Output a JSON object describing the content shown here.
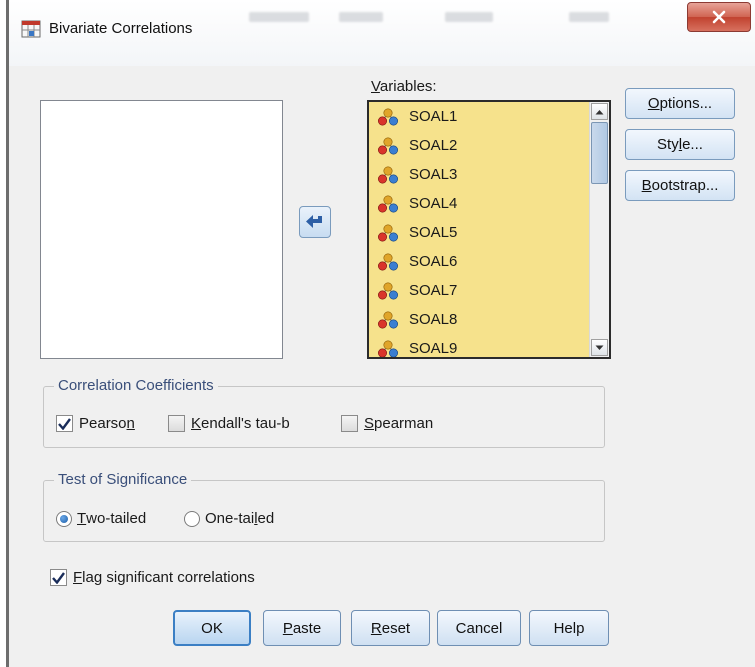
{
  "window": {
    "title": "Bivariate Correlations"
  },
  "variables": {
    "label": "Variables:",
    "label_mnemonic": "V",
    "label_rest": "ariables:",
    "items": [
      "SOAL1",
      "SOAL2",
      "SOAL3",
      "SOAL4",
      "SOAL5",
      "SOAL6",
      "SOAL7",
      "SOAL8",
      "SOAL9"
    ]
  },
  "side_buttons": {
    "options": {
      "pre": "",
      "key": "O",
      "post": "ptions..."
    },
    "style": {
      "pre": "Sty",
      "key": "l",
      "post": "e..."
    },
    "bootstrap": {
      "pre": "",
      "key": "B",
      "post": "ootstrap..."
    }
  },
  "correlation": {
    "legend": "Correlation Coefficients",
    "pearson": {
      "pre": "Pearso",
      "key": "n",
      "post": "",
      "checked": true
    },
    "kendall": {
      "pre": "",
      "key": "K",
      "post": "endall's tau-b",
      "checked": false
    },
    "spearman": {
      "pre": "",
      "key": "S",
      "post": "pearman",
      "checked": false
    }
  },
  "significance": {
    "legend": "Test of Significance",
    "two_tailed": {
      "pre": "",
      "key": "T",
      "post": "wo-tailed",
      "selected": true
    },
    "one_tailed": {
      "pre": "One-tai",
      "key": "l",
      "post": "ed",
      "selected": false
    }
  },
  "flag": {
    "pre": "",
    "key": "F",
    "post": "lag significant correlations",
    "checked": true
  },
  "buttons": {
    "ok": "OK",
    "paste": {
      "pre": "",
      "key": "P",
      "post": "aste"
    },
    "reset": {
      "pre": "",
      "key": "R",
      "post": "eset"
    },
    "cancel": "Cancel",
    "help": "Help"
  },
  "colors": {
    "selection": "#f6e28c",
    "button_border": "#7a9bbd",
    "close_red": "#c1422f",
    "legend_text": "#3a4f7a"
  }
}
